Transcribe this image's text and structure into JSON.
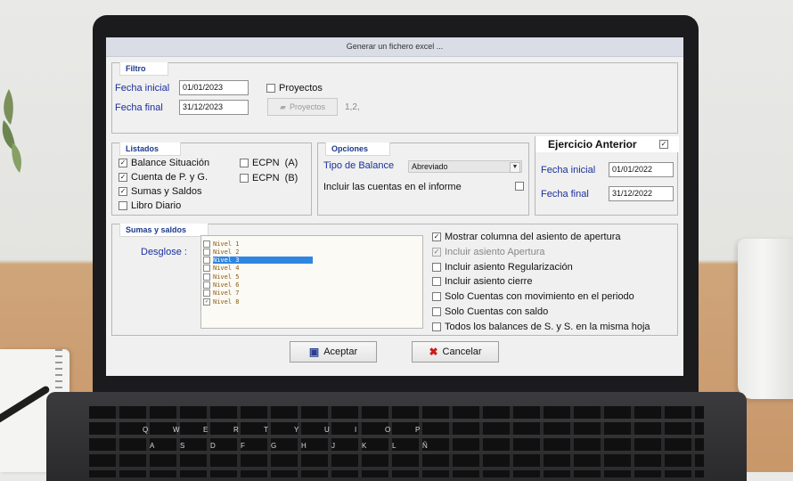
{
  "window": {
    "title": "Generar un fichero excel ..."
  },
  "filtro": {
    "title": "Filtro",
    "fecha_inicial_label": "Fecha inicial",
    "fecha_inicial_value": "01/01/2023",
    "fecha_final_label": "Fecha final",
    "fecha_final_value": "31/12/2023",
    "proyectos_check_label": "Proyectos",
    "proyectos_checked": false,
    "proyectos_button_label": "Proyectos",
    "proyectos_value": "1,2,"
  },
  "listados": {
    "title": "Listados",
    "items": [
      {
        "label": "Balance Situación",
        "checked": true
      },
      {
        "label": "Cuenta de P. y G.",
        "checked": true
      },
      {
        "label": "Sumas y Saldos",
        "checked": true
      },
      {
        "label": "Libro Diario",
        "checked": false
      },
      {
        "label": "ECPN  (A)",
        "checked": false
      },
      {
        "label": "ECPN  (B)",
        "checked": false
      }
    ]
  },
  "opciones": {
    "title": "Opciones",
    "tipo_balance_label": "Tipo de Balance",
    "tipo_balance_value": "Abreviado",
    "incluir_cuentas_label": "Incluir las cuentas en el informe",
    "incluir_cuentas_checked": false
  },
  "ejercicio_anterior": {
    "title": "Ejercicio Anterior",
    "checked": true,
    "fecha_inicial_label": "Fecha inicial",
    "fecha_inicial_value": "01/01/2022",
    "fecha_final_label": "Fecha final",
    "fecha_final_value": "31/12/2022"
  },
  "sumas_saldos": {
    "title": "Sumas y saldos",
    "desglose_label": "Desglose :",
    "niveles": [
      {
        "label": "Nivel 1",
        "checked": false,
        "selected": false
      },
      {
        "label": "Nivel 2",
        "checked": false,
        "selected": false
      },
      {
        "label": "Nivel 3",
        "checked": false,
        "selected": true
      },
      {
        "label": "Nivel 4",
        "checked": false,
        "selected": false
      },
      {
        "label": "Nivel 5",
        "checked": false,
        "selected": false
      },
      {
        "label": "Nivel 6",
        "checked": false,
        "selected": false
      },
      {
        "label": "Nivel 7",
        "checked": false,
        "selected": false
      },
      {
        "label": "Nivel 8",
        "checked": true,
        "selected": false
      }
    ],
    "options": [
      {
        "label": "Mostrar columna del asiento de apertura",
        "checked": true,
        "enabled": true
      },
      {
        "label": "Incluir asiento Apertura",
        "checked": true,
        "enabled": false
      },
      {
        "label": "Incluir asiento Regularización",
        "checked": false,
        "enabled": true
      },
      {
        "label": "Incluir asiento cierre",
        "checked": false,
        "enabled": true
      },
      {
        "label": "Solo Cuentas con movimiento en el periodo",
        "checked": false,
        "enabled": true
      },
      {
        "label": "Solo Cuentas con saldo",
        "checked": false,
        "enabled": true
      },
      {
        "label": "Todos los balances de S. y S. en la misma hoja",
        "checked": false,
        "enabled": true
      }
    ]
  },
  "buttons": {
    "aceptar": "Aceptar",
    "cancelar": "Cancelar"
  },
  "keyboard": [
    "Q",
    "W",
    "E",
    "R",
    "T",
    "Y",
    "U",
    "I",
    "O",
    "P",
    "A",
    "S",
    "D",
    "F",
    "G",
    "H",
    "J",
    "K",
    "L",
    "Ñ"
  ],
  "colors": {
    "label_blue": "#1a2f9c",
    "selection_blue": "#2f86e0",
    "titlebar": "#dadde6"
  }
}
